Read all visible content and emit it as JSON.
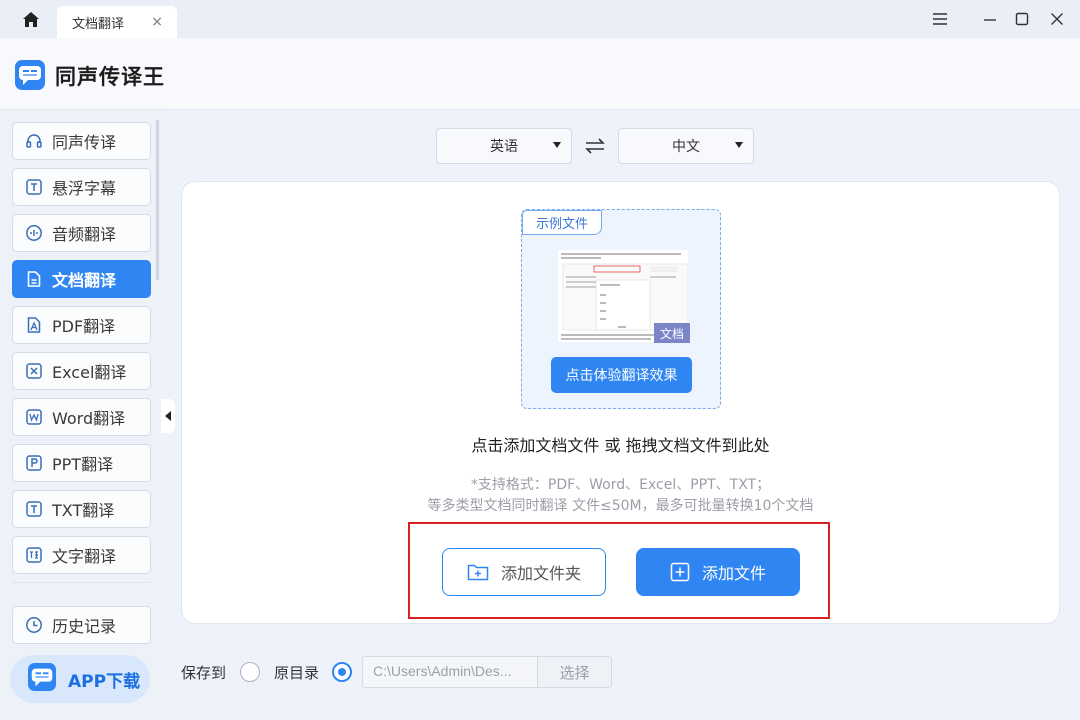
{
  "tab": {
    "label": "文档翻译",
    "close": "×"
  },
  "app": {
    "title": "同声传译王"
  },
  "sidebar": {
    "items": [
      {
        "label": "同声传译",
        "icon": "headphones-icon"
      },
      {
        "label": "悬浮字幕",
        "icon": "text-box-icon"
      },
      {
        "label": "音频翻译",
        "icon": "audio-wave-icon"
      },
      {
        "label": "文档翻译",
        "icon": "document-icon",
        "active": true
      },
      {
        "label": "PDF翻译",
        "icon": "pdf-icon"
      },
      {
        "label": "Excel翻译",
        "icon": "excel-icon"
      },
      {
        "label": "Word翻译",
        "icon": "word-icon"
      },
      {
        "label": "PPT翻译",
        "icon": "ppt-icon"
      },
      {
        "label": "TXT翻译",
        "icon": "txt-icon"
      },
      {
        "label": "文字翻译",
        "icon": "translate-char-icon"
      }
    ],
    "history": "历史记录",
    "app_download": "APP下载"
  },
  "languages": {
    "source": "英语",
    "target": "中文"
  },
  "sample": {
    "tag": "示例文件",
    "badge": "文档",
    "try_button": "点击体验翻译效果"
  },
  "drop_hint": "点击添加文档文件 或 拖拽文档文件到此处",
  "support_line1": "*支持格式：PDF、Word、Excel、PPT、TXT；",
  "support_line2": "等多类型文档同时翻译 文件≤50M，最多可批量转换10个文档",
  "buttons": {
    "add_folder": "添加文件夹",
    "add_file": "添加文件"
  },
  "save": {
    "label": "保存到",
    "original_dir": "原目录",
    "path": "C:\\Users\\Admin\\Des...",
    "choose": "选择",
    "selected": "original"
  },
  "colors": {
    "accent": "#2f86f2",
    "highlight": "#d9201f"
  }
}
